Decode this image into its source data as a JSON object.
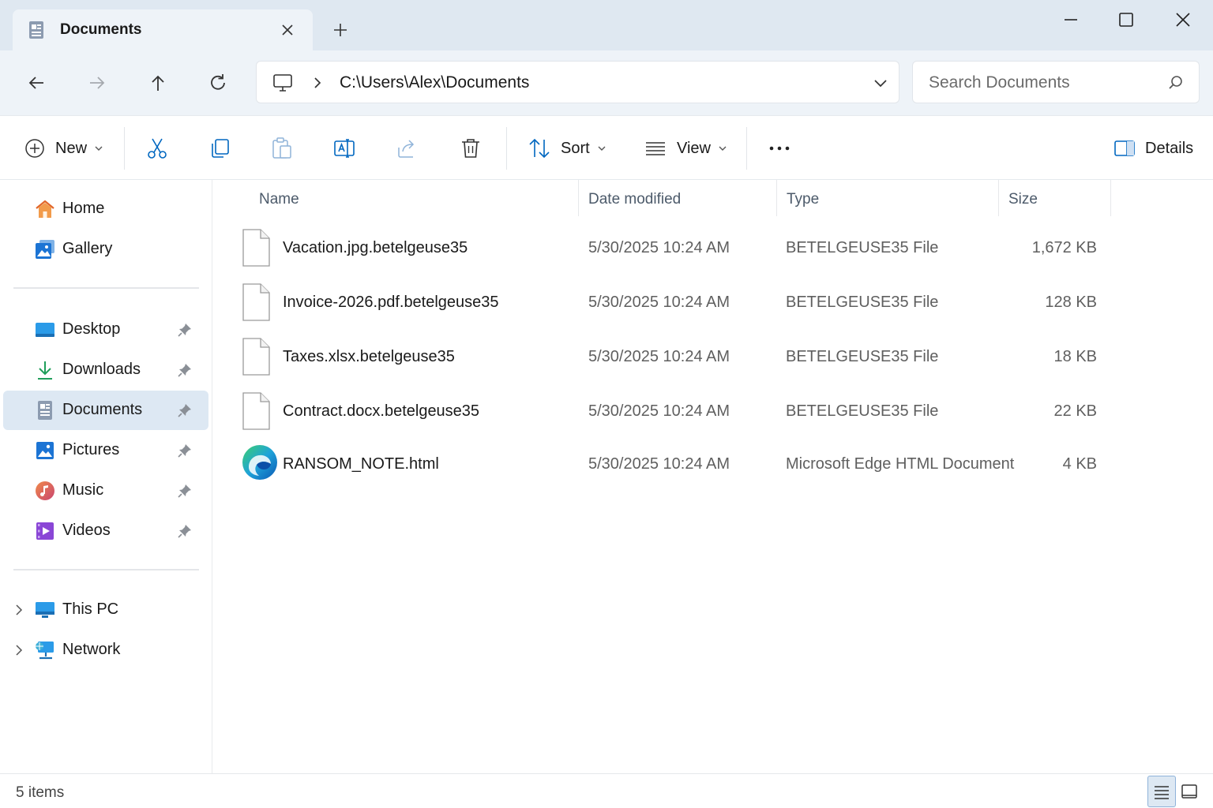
{
  "window": {
    "tab_title": "Documents"
  },
  "address": {
    "path": "C:\\Users\\Alex\\Documents",
    "search_placeholder": "Search Documents"
  },
  "toolbar": {
    "new_label": "New",
    "sort_label": "Sort",
    "view_label": "View",
    "details_label": "Details"
  },
  "sidebar": {
    "quick": [
      {
        "label": "Home",
        "icon": "home-icon"
      },
      {
        "label": "Gallery",
        "icon": "gallery-icon"
      }
    ],
    "pinned": [
      {
        "label": "Desktop",
        "icon": "desktop-icon"
      },
      {
        "label": "Downloads",
        "icon": "downloads-icon"
      },
      {
        "label": "Documents",
        "icon": "documents-icon",
        "selected": true
      },
      {
        "label": "Pictures",
        "icon": "pictures-icon"
      },
      {
        "label": "Music",
        "icon": "music-icon"
      },
      {
        "label": "Videos",
        "icon": "videos-icon"
      }
    ],
    "locations": [
      {
        "label": "This PC",
        "icon": "this-pc-icon"
      },
      {
        "label": "Network",
        "icon": "network-icon"
      }
    ]
  },
  "file_list": {
    "columns": [
      "Name",
      "Date modified",
      "Type",
      "Size"
    ],
    "rows": [
      {
        "name": "Vacation.jpg.betelgeuse35",
        "date": "5/30/2025 10:24 AM",
        "type": "BETELGEUSE35 File",
        "size": "1,672 KB",
        "icon": "blank-file-icon"
      },
      {
        "name": "Invoice-2026.pdf.betelgeuse35",
        "date": "5/30/2025 10:24 AM",
        "type": "BETELGEUSE35 File",
        "size": "128 KB",
        "icon": "blank-file-icon"
      },
      {
        "name": "Taxes.xlsx.betelgeuse35",
        "date": "5/30/2025 10:24 AM",
        "type": "BETELGEUSE35 File",
        "size": "18 KB",
        "icon": "blank-file-icon"
      },
      {
        "name": "Contract.docx.betelgeuse35",
        "date": "5/30/2025 10:24 AM",
        "type": "BETELGEUSE35 File",
        "size": "22 KB",
        "icon": "blank-file-icon"
      },
      {
        "name": "RANSOM_NOTE.html",
        "date": "5/30/2025 10:24 AM",
        "type": "Microsoft Edge HTML Document",
        "size": "4 KB",
        "icon": "edge-icon"
      }
    ]
  },
  "status": {
    "item_count": "5 items"
  },
  "colors": {
    "accent": "#0067c0",
    "selection": "#dde8f3",
    "titlebar": "#dfe8f1"
  }
}
